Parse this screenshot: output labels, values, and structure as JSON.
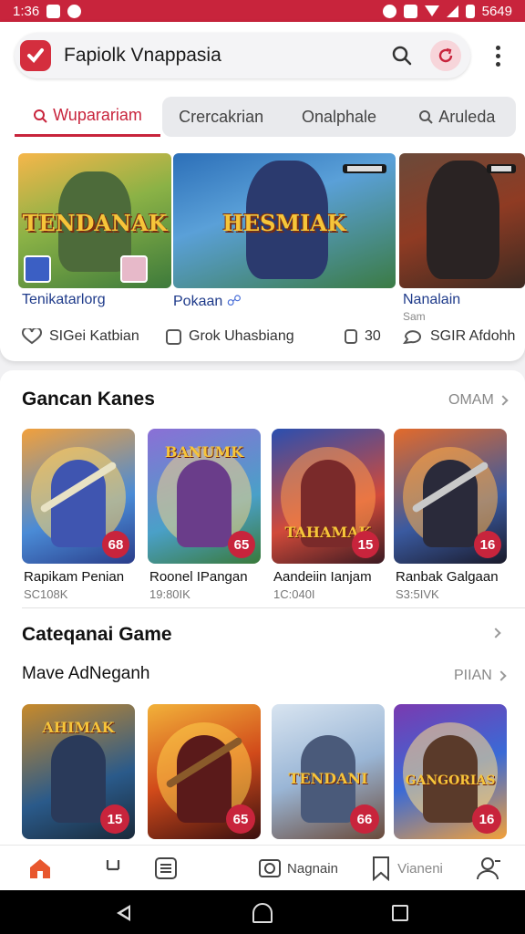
{
  "status_bar": {
    "time": "1:36",
    "battery": "5649"
  },
  "header": {
    "title": "Fapiolk Vnappasia"
  },
  "tabs": [
    {
      "label": "Wuparariam",
      "active": true
    },
    {
      "label": "Crercakrian"
    },
    {
      "label": "Onalphale"
    },
    {
      "label": "Aruleda"
    }
  ],
  "featured": [
    {
      "art_text": "TENDANAK",
      "caption": "Tenikatarlorg",
      "sub": ""
    },
    {
      "art_text": "HESMIAK",
      "caption": "Pokaan",
      "sub": ""
    },
    {
      "art_text": "",
      "caption": "Nanalain",
      "sub": "Sam"
    }
  ],
  "featured_meta": [
    {
      "label": "SIGei Katbian"
    },
    {
      "label": "Grok Uhasbiang"
    },
    {
      "label": "30"
    },
    {
      "label": "SGIR Afdohh"
    }
  ],
  "section1": {
    "title": "Gancan Kanes",
    "more": "OMAM",
    "cards": [
      {
        "title": "Rapikam Penian",
        "sub": "SC108K",
        "rating": "68",
        "art": ""
      },
      {
        "title": "Roonel IPangan",
        "sub": "19:80IK",
        "rating": "65",
        "art": "BANUMK"
      },
      {
        "title": "Aandeiin Ianjam",
        "sub": "1C:040I",
        "rating": "15",
        "art": "TAHAMAK"
      },
      {
        "title": "Ranbak Galgaan",
        "sub": "S3:5IVK",
        "rating": "16",
        "art": ""
      }
    ]
  },
  "section2": {
    "title": "Cateqanai Game",
    "subtitle": "Mave AdNeganh",
    "more": "PIIAN",
    "cards": [
      {
        "rating": "15",
        "art": "AHIMAK"
      },
      {
        "rating": "65",
        "art": ""
      },
      {
        "rating": "66",
        "art": "TENDANI"
      },
      {
        "rating": "16",
        "art": "GANGORIAS"
      }
    ]
  },
  "bottom_nav": [
    {
      "label": ""
    },
    {
      "label": ""
    },
    {
      "label": ""
    },
    {
      "label": "Nagnain"
    },
    {
      "label": "Vianeni"
    },
    {
      "label": ""
    }
  ],
  "colors": {
    "accent": "#c8243c",
    "link": "#1e3a8a"
  }
}
